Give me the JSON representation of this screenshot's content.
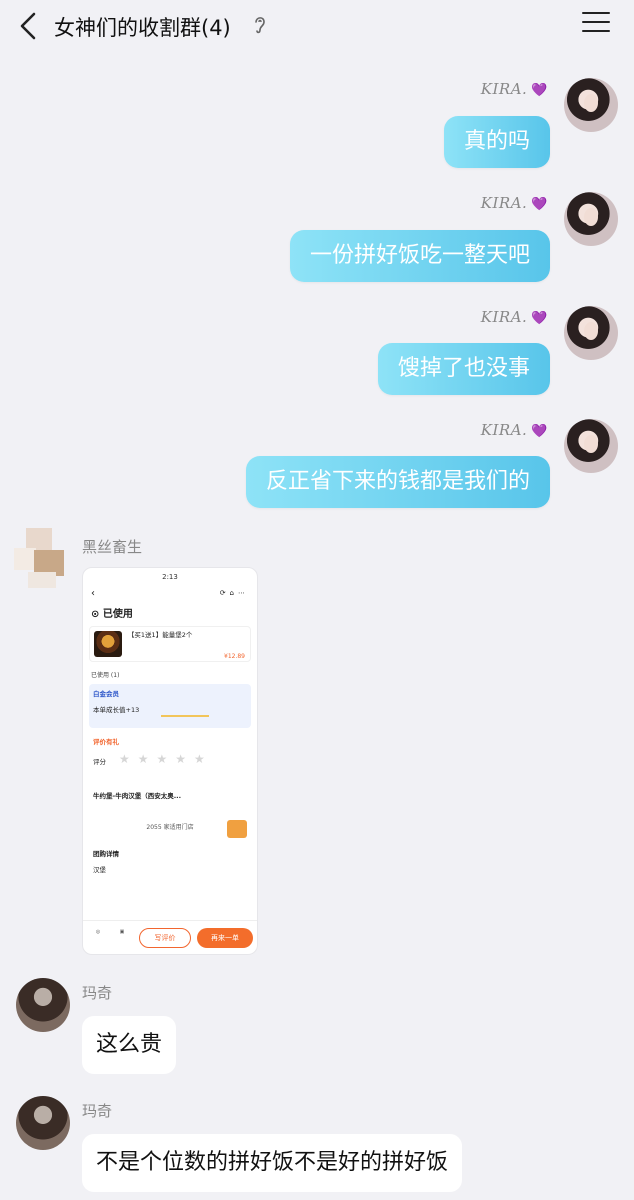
{
  "header": {
    "title": "女神们的收割群(4)"
  },
  "messages_right": [
    {
      "sender": "KIRA.",
      "heart": "💜",
      "text": "真的吗"
    },
    {
      "sender": "KIRA.",
      "heart": "💜",
      "text": "一份拼好饭吃一整天吧"
    },
    {
      "sender": "KIRA.",
      "heart": "💜",
      "text": "馊掉了也没事"
    },
    {
      "sender": "KIRA.",
      "heart": "💜",
      "text": "反正省下来的钱都是我们的"
    }
  ],
  "screenshot_msg": {
    "sender": "黑丝畜生",
    "shot": {
      "status_time": "2:13",
      "used_label": "已使用",
      "product_title": "【买1送1】能量堡2个",
      "price": "¥12.89",
      "used_count": "已使用 (1)",
      "vip_title": "白金会员",
      "vip_growth": "本单成长值+13",
      "review_title": "评价有礼",
      "rating_label": "评分",
      "stars": "★★★★★",
      "store_name": "牛约堡-牛肉汉堡（西安太奥...",
      "store_count": "2055 家适用门店",
      "detail_title": "团购详情",
      "detail_item": "汉堡",
      "btn_review": "写评价",
      "btn_again": "再来一单"
    }
  },
  "messages_left": [
    {
      "sender": "玛奇",
      "text": "这么贵"
    },
    {
      "sender": "玛奇",
      "text": "不是个位数的拼好饭不是好的拼好饭"
    }
  ]
}
